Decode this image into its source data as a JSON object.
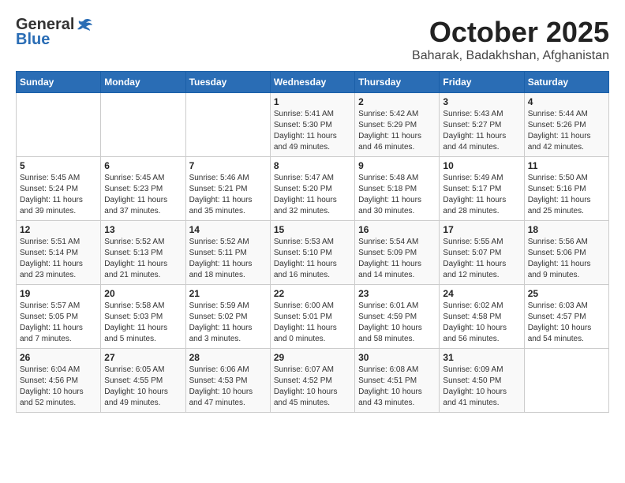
{
  "header": {
    "logo_general": "General",
    "logo_blue": "Blue",
    "title": "October 2025",
    "location": "Baharak, Badakhshan, Afghanistan"
  },
  "weekdays": [
    "Sunday",
    "Monday",
    "Tuesday",
    "Wednesday",
    "Thursday",
    "Friday",
    "Saturday"
  ],
  "weeks": [
    [
      {
        "day": "",
        "info": ""
      },
      {
        "day": "",
        "info": ""
      },
      {
        "day": "",
        "info": ""
      },
      {
        "day": "1",
        "info": "Sunrise: 5:41 AM\nSunset: 5:30 PM\nDaylight: 11 hours\nand 49 minutes."
      },
      {
        "day": "2",
        "info": "Sunrise: 5:42 AM\nSunset: 5:29 PM\nDaylight: 11 hours\nand 46 minutes."
      },
      {
        "day": "3",
        "info": "Sunrise: 5:43 AM\nSunset: 5:27 PM\nDaylight: 11 hours\nand 44 minutes."
      },
      {
        "day": "4",
        "info": "Sunrise: 5:44 AM\nSunset: 5:26 PM\nDaylight: 11 hours\nand 42 minutes."
      }
    ],
    [
      {
        "day": "5",
        "info": "Sunrise: 5:45 AM\nSunset: 5:24 PM\nDaylight: 11 hours\nand 39 minutes."
      },
      {
        "day": "6",
        "info": "Sunrise: 5:45 AM\nSunset: 5:23 PM\nDaylight: 11 hours\nand 37 minutes."
      },
      {
        "day": "7",
        "info": "Sunrise: 5:46 AM\nSunset: 5:21 PM\nDaylight: 11 hours\nand 35 minutes."
      },
      {
        "day": "8",
        "info": "Sunrise: 5:47 AM\nSunset: 5:20 PM\nDaylight: 11 hours\nand 32 minutes."
      },
      {
        "day": "9",
        "info": "Sunrise: 5:48 AM\nSunset: 5:18 PM\nDaylight: 11 hours\nand 30 minutes."
      },
      {
        "day": "10",
        "info": "Sunrise: 5:49 AM\nSunset: 5:17 PM\nDaylight: 11 hours\nand 28 minutes."
      },
      {
        "day": "11",
        "info": "Sunrise: 5:50 AM\nSunset: 5:16 PM\nDaylight: 11 hours\nand 25 minutes."
      }
    ],
    [
      {
        "day": "12",
        "info": "Sunrise: 5:51 AM\nSunset: 5:14 PM\nDaylight: 11 hours\nand 23 minutes."
      },
      {
        "day": "13",
        "info": "Sunrise: 5:52 AM\nSunset: 5:13 PM\nDaylight: 11 hours\nand 21 minutes."
      },
      {
        "day": "14",
        "info": "Sunrise: 5:52 AM\nSunset: 5:11 PM\nDaylight: 11 hours\nand 18 minutes."
      },
      {
        "day": "15",
        "info": "Sunrise: 5:53 AM\nSunset: 5:10 PM\nDaylight: 11 hours\nand 16 minutes."
      },
      {
        "day": "16",
        "info": "Sunrise: 5:54 AM\nSunset: 5:09 PM\nDaylight: 11 hours\nand 14 minutes."
      },
      {
        "day": "17",
        "info": "Sunrise: 5:55 AM\nSunset: 5:07 PM\nDaylight: 11 hours\nand 12 minutes."
      },
      {
        "day": "18",
        "info": "Sunrise: 5:56 AM\nSunset: 5:06 PM\nDaylight: 11 hours\nand 9 minutes."
      }
    ],
    [
      {
        "day": "19",
        "info": "Sunrise: 5:57 AM\nSunset: 5:05 PM\nDaylight: 11 hours\nand 7 minutes."
      },
      {
        "day": "20",
        "info": "Sunrise: 5:58 AM\nSunset: 5:03 PM\nDaylight: 11 hours\nand 5 minutes."
      },
      {
        "day": "21",
        "info": "Sunrise: 5:59 AM\nSunset: 5:02 PM\nDaylight: 11 hours\nand 3 minutes."
      },
      {
        "day": "22",
        "info": "Sunrise: 6:00 AM\nSunset: 5:01 PM\nDaylight: 11 hours\nand 0 minutes."
      },
      {
        "day": "23",
        "info": "Sunrise: 6:01 AM\nSunset: 4:59 PM\nDaylight: 10 hours\nand 58 minutes."
      },
      {
        "day": "24",
        "info": "Sunrise: 6:02 AM\nSunset: 4:58 PM\nDaylight: 10 hours\nand 56 minutes."
      },
      {
        "day": "25",
        "info": "Sunrise: 6:03 AM\nSunset: 4:57 PM\nDaylight: 10 hours\nand 54 minutes."
      }
    ],
    [
      {
        "day": "26",
        "info": "Sunrise: 6:04 AM\nSunset: 4:56 PM\nDaylight: 10 hours\nand 52 minutes."
      },
      {
        "day": "27",
        "info": "Sunrise: 6:05 AM\nSunset: 4:55 PM\nDaylight: 10 hours\nand 49 minutes."
      },
      {
        "day": "28",
        "info": "Sunrise: 6:06 AM\nSunset: 4:53 PM\nDaylight: 10 hours\nand 47 minutes."
      },
      {
        "day": "29",
        "info": "Sunrise: 6:07 AM\nSunset: 4:52 PM\nDaylight: 10 hours\nand 45 minutes."
      },
      {
        "day": "30",
        "info": "Sunrise: 6:08 AM\nSunset: 4:51 PM\nDaylight: 10 hours\nand 43 minutes."
      },
      {
        "day": "31",
        "info": "Sunrise: 6:09 AM\nSunset: 4:50 PM\nDaylight: 10 hours\nand 41 minutes."
      },
      {
        "day": "",
        "info": ""
      }
    ]
  ]
}
